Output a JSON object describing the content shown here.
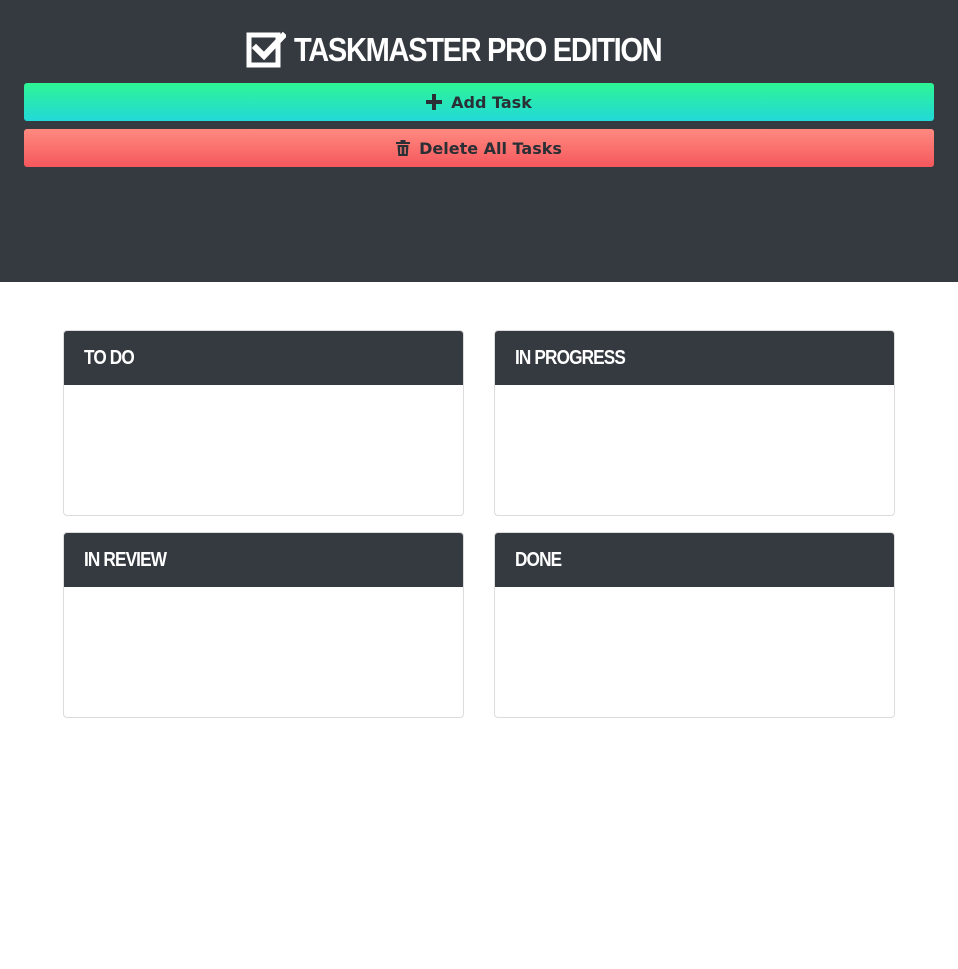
{
  "app": {
    "title": "TASKMASTER PRO EDITION",
    "icon": "check-square-icon"
  },
  "toolbar": {
    "add_label": "Add Task",
    "add_icon": "plus-icon",
    "delete_label": "Delete All Tasks",
    "delete_icon": "trash-icon"
  },
  "board": {
    "columns": [
      {
        "title": "TO DO",
        "tasks": []
      },
      {
        "title": "IN PROGRESS",
        "tasks": []
      },
      {
        "title": "IN REVIEW",
        "tasks": []
      },
      {
        "title": "DONE",
        "tasks": []
      }
    ]
  },
  "colors": {
    "header_bg": "#343a40",
    "add_gradient": [
      "#2ef594",
      "#22d9d9"
    ],
    "delete_gradient": [
      "#ff8a80",
      "#f5575c"
    ]
  }
}
